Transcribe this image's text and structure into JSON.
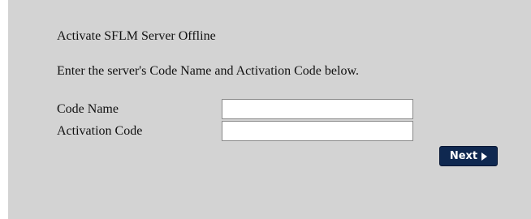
{
  "page": {
    "title": "Activate SFLM Server Offline",
    "instructions": "Enter the server's Code Name and Activation Code below."
  },
  "form": {
    "code_name": {
      "label": "Code Name",
      "value": ""
    },
    "activation_code": {
      "label": "Activation Code",
      "value": ""
    }
  },
  "actions": {
    "next_label": "Next",
    "next_icon": "play-arrow-icon"
  },
  "colors": {
    "panel_background": "#d3d3d3",
    "button_background": "#0f2850",
    "button_text": "#ffffff"
  }
}
